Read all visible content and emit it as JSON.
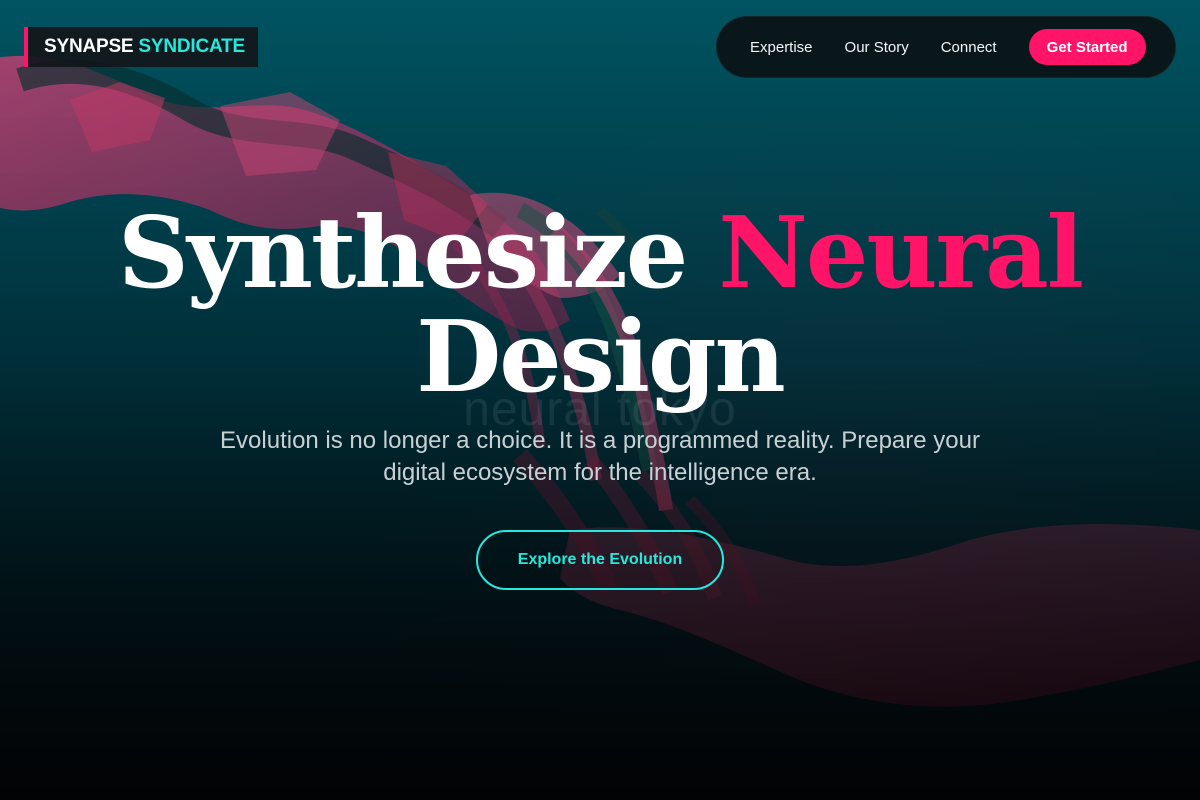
{
  "brand": {
    "name_primary": "SYNAPSE",
    "name_accent": "SYNDICATE"
  },
  "nav": {
    "items": [
      {
        "label": "Expertise"
      },
      {
        "label": "Our Story"
      },
      {
        "label": "Connect"
      }
    ],
    "cta_label": "Get Started"
  },
  "hero": {
    "title_part1": "Synthesize ",
    "title_highlight": "Neural",
    "title_line2": "Design",
    "watermark": "neural tokyo",
    "subtitle": "Evolution is no longer a choice. It is a programmed reality. Prepare your digital ecosystem for the intelligence era.",
    "cta_label": "Explore the Evolution"
  },
  "colors": {
    "accent_pink": "#ff1467",
    "accent_cyan": "#26e8dc",
    "background_teal": "#005a69"
  }
}
